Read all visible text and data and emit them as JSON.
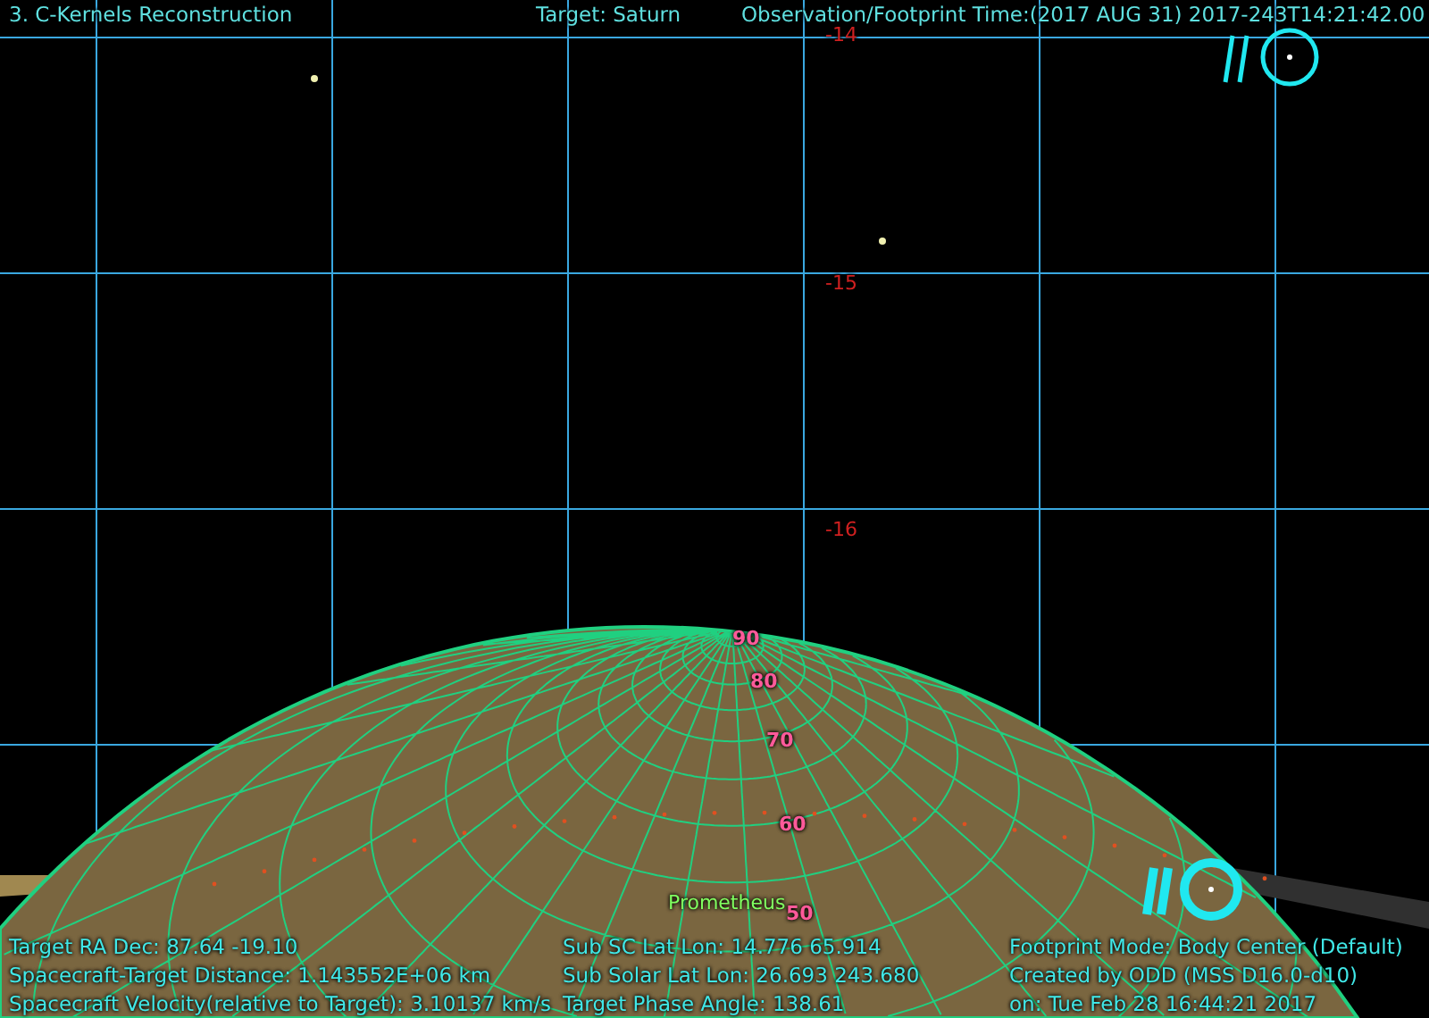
{
  "header": {
    "title": "3. C-Kernels Reconstruction",
    "target": "Target: Saturn",
    "time": "Observation/Footprint Time:(2017 AUG 31) 2017-243T14:21:42.00"
  },
  "declination_labels": [
    "-14",
    "-15",
    "-16"
  ],
  "latitude_labels": [
    "90",
    "80",
    "70",
    "60",
    "50"
  ],
  "moon_label": "Prometheus",
  "info_columns": [
    {
      "lines": [
        "Target RA Dec: 87.64  -19.10",
        "Spacecraft-Target Distance: 1.143552E+06 km",
        "Spacecraft Velocity(relative to Target): 3.10137 km/s"
      ]
    },
    {
      "lines": [
        "Sub SC Lat Lon: 14.776  65.914",
        "Sub Solar Lat Lon: 26.693  243.680",
        "Target Phase Angle: 138.61"
      ]
    },
    {
      "lines": [
        "Footprint Mode: Body Center (Default)",
        "Created by ODD (MSS D16.0-d10)",
        "on: Tue Feb 28 16:44:21 2017"
      ]
    }
  ]
}
